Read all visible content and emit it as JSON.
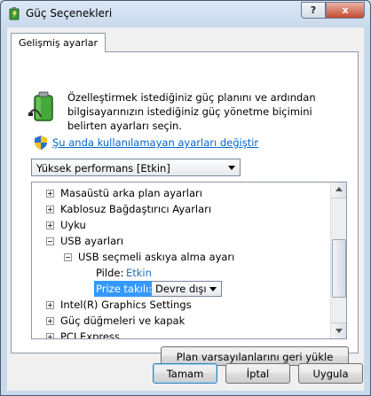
{
  "window": {
    "title": "Güç Seçenekleri",
    "help_label": "?",
    "close_label": "x"
  },
  "tab": {
    "label": "Gelişmiş ayarlar"
  },
  "description": "Özelleştirmek istediğiniz güç planını ve ardından bilgisayarınızın istediğiniz güç yönetme biçimini belirten ayarları seçin.",
  "change_link": "Şu anda kullanılamayan ayarları değiştir",
  "plan_select": {
    "value": "Yüksek performans [Etkin]"
  },
  "tree": {
    "items": [
      {
        "label": "Masaüstü arka plan ayarları",
        "expanded": false
      },
      {
        "label": "Kablosuz Bağdaştırıcı Ayarları",
        "expanded": false
      },
      {
        "label": "Uyku",
        "expanded": false
      },
      {
        "label": "USB ayarları",
        "expanded": true
      },
      {
        "label": "USB seçmeli askıya alma ayarı",
        "expanded": true
      },
      {
        "label": "Pilde:",
        "value": "Etkin"
      },
      {
        "label": "Prize takılı:",
        "value": "Devre dışı"
      },
      {
        "label": "Intel(R) Graphics Settings",
        "expanded": false
      },
      {
        "label": "Güç düğmeleri ve kapak",
        "expanded": false
      },
      {
        "label": "PCI Express",
        "expanded": false
      }
    ]
  },
  "buttons": {
    "restore": "Plan varsayılanlarını geri yükle",
    "ok": "Tamam",
    "cancel": "İptal",
    "apply": "Uygula"
  },
  "colors": {
    "link": "#0066cc",
    "selection": "#3399ff"
  }
}
